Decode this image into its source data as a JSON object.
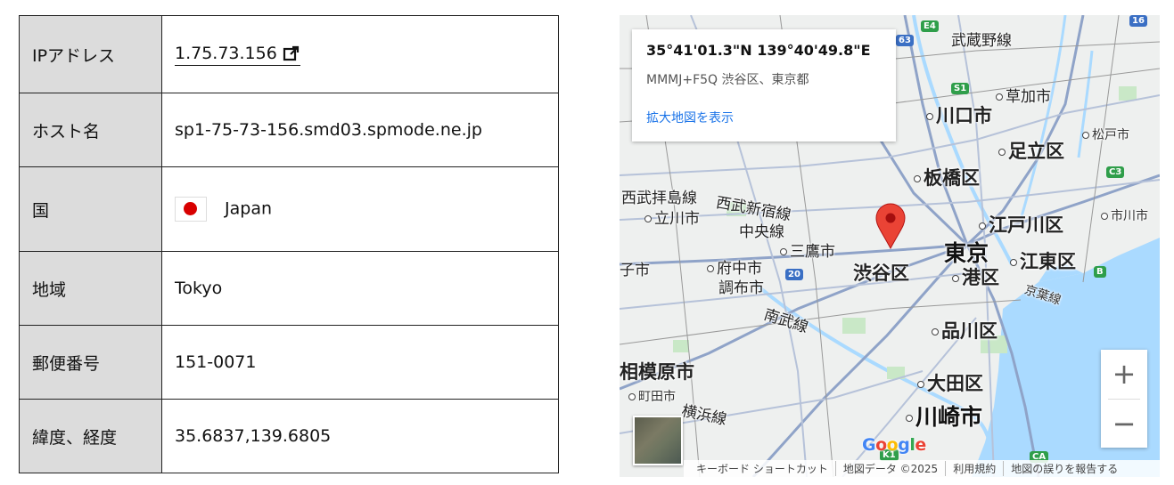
{
  "table": {
    "rows": [
      {
        "label": "IPアドレス",
        "value": "1.75.73.156"
      },
      {
        "label": "ホスト名",
        "value": "sp1-75-73-156.smd03.spmode.ne.jp"
      },
      {
        "label": "国",
        "value": "Japan"
      },
      {
        "label": "地域",
        "value": "Tokyo"
      },
      {
        "label": "郵便番号",
        "value": "151-0071"
      },
      {
        "label": "緯度、経度",
        "value": "35.6837,139.6805"
      }
    ]
  },
  "map": {
    "card": {
      "coords": "35°41'01.3\"N 139°40'49.8\"E",
      "plus_code": "MMMJ+F5Q 渋谷区、東京都",
      "link": "拡大地図を表示"
    },
    "labels": {
      "musashino_line": "武蔵野線",
      "kawaguchi": "川口市",
      "soka": "草加市",
      "matsudo": "松戸市",
      "adachi": "足立区",
      "itabashi": "板橋区",
      "nishi_haijima": "西武拝島線",
      "tachikawa": "立川市",
      "seibu_shinjuku": "西武新宿線",
      "edogawa": "江戸川区",
      "ichikawa": "市川市",
      "chuo_line": "中央線",
      "mitaka": "三鷹市",
      "tokyo": "東京",
      "fuchu": "府中市",
      "shibuya": "渋谷区",
      "minato": "港区",
      "koto": "江東区",
      "chofu": "調布市",
      "keiyo_line": "京葉線",
      "nanbu_line": "南武線",
      "shinagawa": "品川区",
      "sagamihara": "相模原市",
      "machida": "町田市",
      "ota": "大田区",
      "yokohama_line": "横浜線",
      "kawasaki": "川崎市",
      "hachioji_part": "子市",
      "shi_edge": "市"
    },
    "shields": {
      "e4": "E4",
      "s1": "S1",
      "c3": "C3",
      "r63": "63",
      "r16": "16",
      "r20": "20",
      "b": "B",
      "ca": "CA",
      "k1": "K1"
    },
    "zoom_in": "+",
    "zoom_out": "−",
    "google": {
      "g1": "G",
      "o1": "o",
      "o2": "o",
      "g2": "g",
      "l": "l",
      "e": "e"
    },
    "attribution": {
      "shortcuts": "キーボード ショートカット",
      "map_data": "地図データ ©2025",
      "terms": "利用規約",
      "report": "地図の誤りを報告する"
    },
    "colors": {
      "water": "#aadaff",
      "road": "#8fa3c8",
      "pin": "#ea4335",
      "park": "#c9e8c7"
    }
  }
}
